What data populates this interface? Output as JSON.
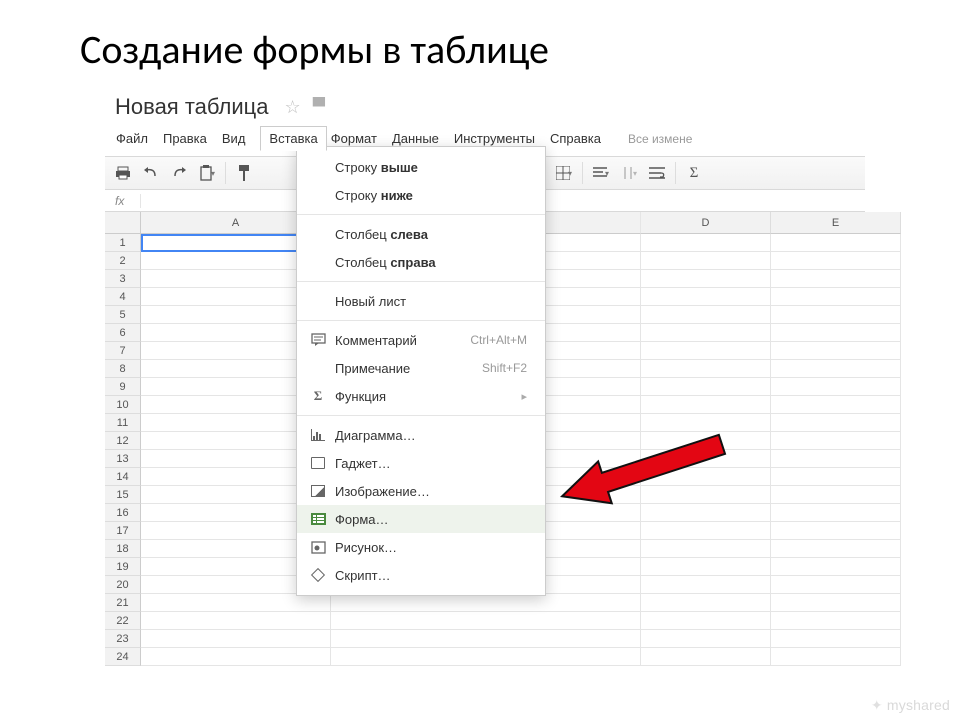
{
  "slide_title": "Создание формы в таблице",
  "doc_title": "Новая таблица",
  "menubar": {
    "items": [
      "Файл",
      "Правка",
      "Вид",
      "Вставка",
      "Формат",
      "Данные",
      "Инструменты",
      "Справка"
    ],
    "active_index": 3,
    "tail": "Все измене"
  },
  "fx_label": "fx",
  "columns": [
    "A",
    "D",
    "E"
  ],
  "rows": [
    "1",
    "2",
    "3",
    "4",
    "5",
    "6",
    "7",
    "8",
    "9",
    "10",
    "11",
    "12",
    "13",
    "14",
    "15",
    "16",
    "17",
    "18",
    "19",
    "20",
    "21",
    "22",
    "23",
    "24"
  ],
  "dropdown": {
    "row_above_pre": "Строку ",
    "row_above_bold": "выше",
    "row_below_pre": "Строку ",
    "row_below_bold": "ниже",
    "col_left_pre": "Столбец ",
    "col_left_bold": "слева",
    "col_right_pre": "Столбец ",
    "col_right_bold": "справа",
    "new_sheet": "Новый лист",
    "comment": "Комментарий",
    "comment_shortcut": "Ctrl+Alt+M",
    "note": "Примечание",
    "note_shortcut": "Shift+F2",
    "function": "Функция",
    "chart": "Диаграмма…",
    "gadget": "Гаджет…",
    "image": "Изображение…",
    "form": "Форма…",
    "drawing": "Рисунок…",
    "script": "Скрипт…"
  },
  "watermark": "myshared"
}
